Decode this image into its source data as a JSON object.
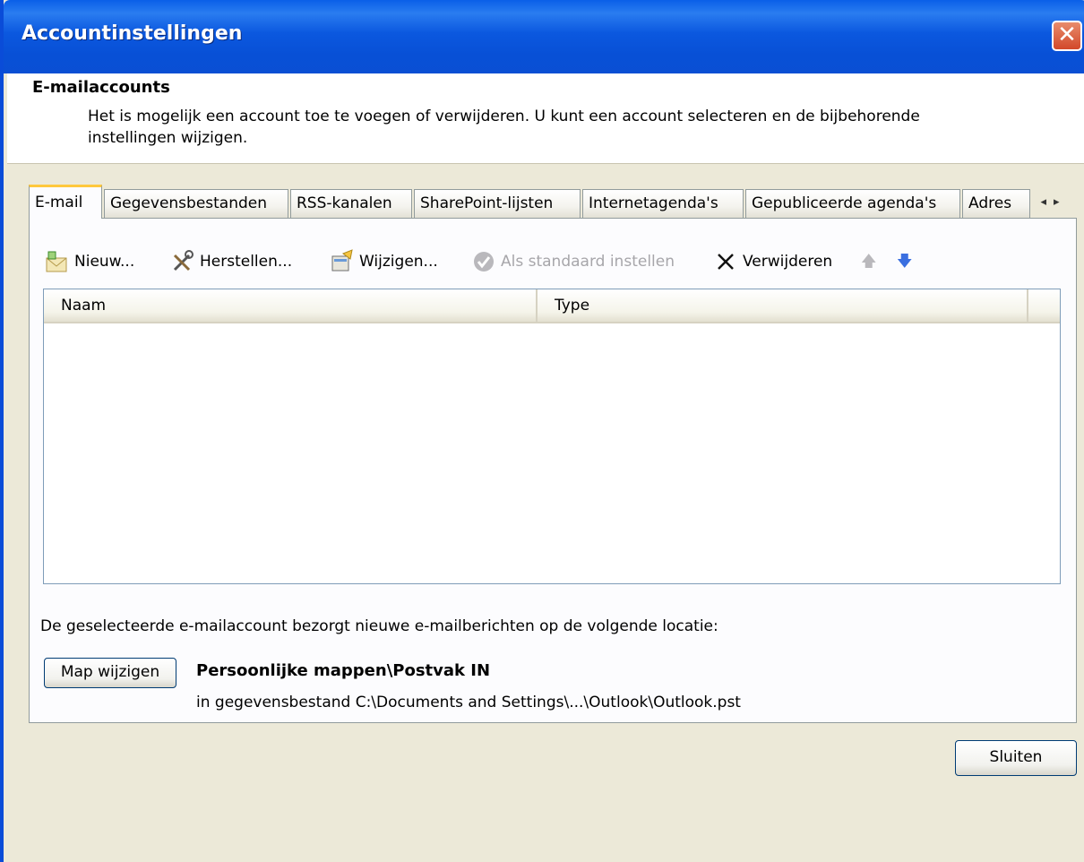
{
  "window": {
    "title": "Accountinstellingen",
    "close_glyph": "✕"
  },
  "header": {
    "title": "E-mailaccounts",
    "description": "Het is mogelijk een account toe te voegen of verwijderen. U kunt een account selecteren en de bijbehorende instellingen wijzigen."
  },
  "tabs": [
    {
      "label": "E-mail",
      "active": true
    },
    {
      "label": "Gegevensbestanden",
      "active": false
    },
    {
      "label": "RSS-kanalen",
      "active": false
    },
    {
      "label": "SharePoint-lijsten",
      "active": false
    },
    {
      "label": "Internetagenda's",
      "active": false
    },
    {
      "label": "Gepubliceerde agenda's",
      "active": false
    },
    {
      "label": "Adres",
      "active": false
    }
  ],
  "tab_scroll": {
    "left": "◂",
    "right": "▸"
  },
  "toolbar": {
    "new_label": "Nieuw...",
    "repair_label": "Herstellen...",
    "change_label": "Wijzigen...",
    "default_label": "Als standaard instellen",
    "remove_label": "Verwijderen",
    "up_glyph": "🡅",
    "down_glyph": "🡇"
  },
  "table": {
    "columns": [
      "Naam",
      "Type"
    ],
    "rows": []
  },
  "location": {
    "description": "De geselecteerde e-mailaccount bezorgt nieuwe e-mailberichten op de volgende locatie:",
    "change_button": "Map wijzigen",
    "folder": "Persoonlijke mappen\\Postvak IN",
    "file": "in gegevensbestand C:\\Documents and Settings\\...\\Outlook\\Outlook.pst"
  },
  "footer": {
    "close_button": "Sluiten"
  },
  "colors": {
    "titlebar": "#0a5fe8",
    "dialog_bg": "#ece9d8",
    "active_tab_accent": "#ffc83c",
    "disabled_text": "#a7a6aa"
  }
}
